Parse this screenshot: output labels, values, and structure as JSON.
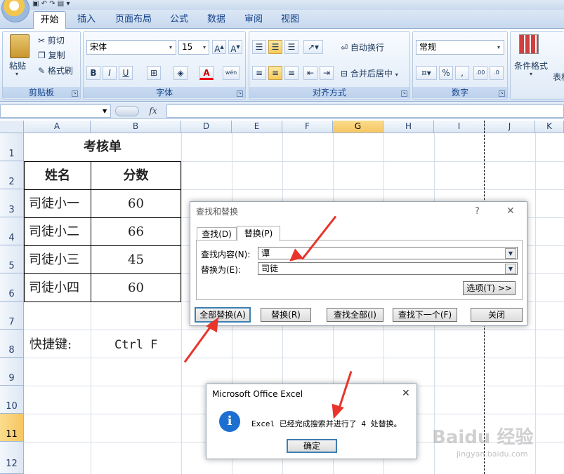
{
  "ribbon": {
    "tabs": [
      "开始",
      "插入",
      "页面布局",
      "公式",
      "数据",
      "审阅",
      "视图"
    ],
    "clipboard": {
      "paste": "粘贴",
      "cut": "剪切",
      "copy": "复制",
      "format_painter": "格式刷",
      "label": "剪贴板"
    },
    "font": {
      "name": "宋体",
      "size": "15",
      "label": "字体"
    },
    "alignment": {
      "wrap": "自动换行",
      "merge": "合并后居中",
      "label": "对齐方式"
    },
    "number": {
      "format": "常规",
      "label": "数字"
    },
    "styles": {
      "conditional": "条件格式",
      "table": "表格"
    }
  },
  "grid": {
    "columns": [
      "A",
      "B",
      "D",
      "E",
      "F",
      "G",
      "H",
      "I",
      "J",
      "K"
    ],
    "selected_column": "G",
    "rows": [
      "1",
      "2",
      "3",
      "4",
      "5",
      "6",
      "7",
      "8",
      "9",
      "10",
      "11",
      "12"
    ],
    "selected_row": "11",
    "title": "考核单",
    "headers": [
      "姓名",
      "分数"
    ],
    "data": [
      {
        "name": "司徒小一",
        "score": "60"
      },
      {
        "name": "司徒小二",
        "score": "66"
      },
      {
        "name": "司徒小三",
        "score": "45"
      },
      {
        "name": "司徒小四",
        "score": "60"
      }
    ],
    "shortcut_label": "快捷键:",
    "shortcut_value": "Ctrl F"
  },
  "find_dialog": {
    "title": "查找和替换",
    "help": "?",
    "close": "✕",
    "tabs": [
      "查找(D)",
      "替换(P)"
    ],
    "find_label": "查找内容(N):",
    "find_value": "谭",
    "replace_label": "替换为(E):",
    "replace_value": "司徒",
    "options": "选项(T) >>",
    "buttons": [
      "全部替换(A)",
      "替换(R)",
      "查找全部(I)",
      "查找下一个(F)",
      "关闭"
    ]
  },
  "msg_dialog": {
    "title": "Microsoft Office Excel",
    "close": "✕",
    "icon": "i",
    "message": "Excel 已经完成搜索并进行了 4 处替换。",
    "ok": "确定"
  },
  "watermark": {
    "brand": "Baidu 经验",
    "url": "jingyan.baidu.com"
  },
  "colors": {
    "accent": "#e8342a",
    "ribbon": "#dfe9f5",
    "info": "#1c6fd1"
  }
}
